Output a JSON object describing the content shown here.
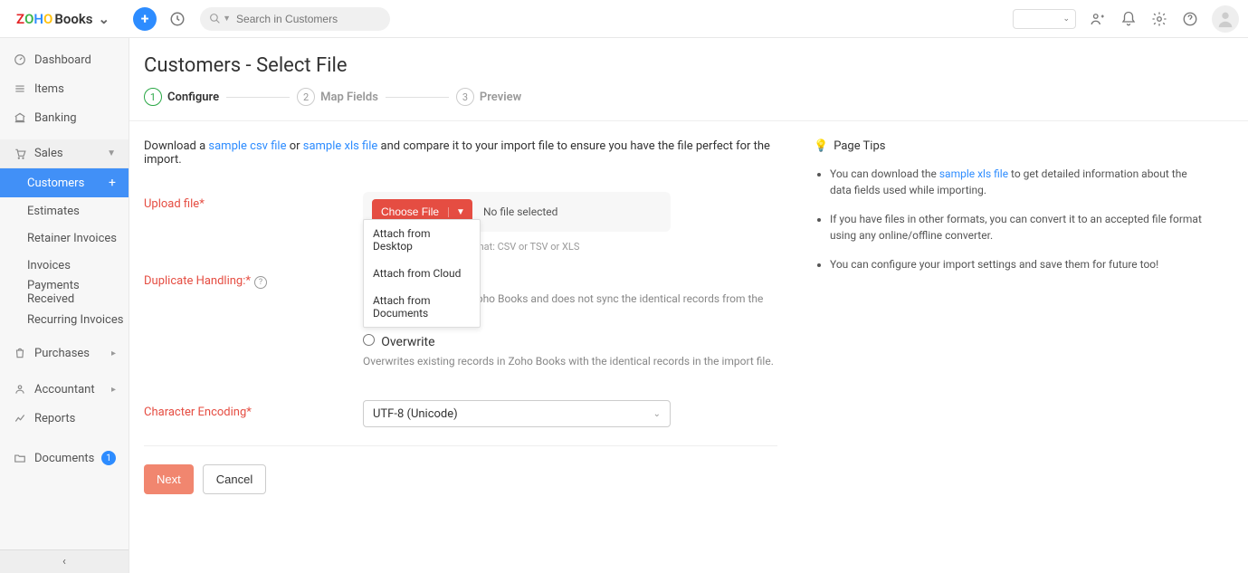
{
  "brand": {
    "books": "Books"
  },
  "search": {
    "placeholder": "Search in Customers"
  },
  "sidebar": {
    "items": [
      {
        "label": "Dashboard"
      },
      {
        "label": "Items"
      },
      {
        "label": "Banking"
      }
    ],
    "sales_label": "Sales",
    "sales_items": [
      "Customers",
      "Estimates",
      "Retainer Invoices",
      "Invoices",
      "Payments Received",
      "Recurring Invoices"
    ],
    "purchases_label": "Purchases",
    "accountant_label": "Accountant",
    "reports_label": "Reports",
    "documents_label": "Documents",
    "documents_badge": "1"
  },
  "page": {
    "title": "Customers - Select File"
  },
  "steps": [
    {
      "num": "1",
      "label": "Configure"
    },
    {
      "num": "2",
      "label": "Map Fields"
    },
    {
      "num": "3",
      "label": "Preview"
    }
  ],
  "intro": {
    "pre": "Download a ",
    "csv": "sample csv file",
    "or": " or ",
    "xls": "sample xls file",
    "post": " and compare it to your import file to ensure you have the file perfect for the import."
  },
  "form": {
    "upload_label": "Upload file*",
    "choose_file": "Choose File",
    "no_file": "No file selected",
    "file_format_prefix": "File Format: ",
    "file_format_value": "CSV or TSV or XLS",
    "attach_menu": [
      "Attach from Desktop",
      "Attach from Cloud",
      "Attach from Documents"
    ],
    "dup_label": "Duplicate Handling:*",
    "skip_desc": "Retains the records in Zoho Books and does not sync the identical records from the import file.",
    "overwrite_label": "Overwrite",
    "overwrite_desc": "Overwrites existing records in Zoho Books with the identical records in the import file.",
    "encoding_label": "Character Encoding*",
    "encoding_value": "UTF-8 (Unicode)",
    "next": "Next",
    "cancel": "Cancel"
  },
  "tips": {
    "title": "Page Tips",
    "items": [
      {
        "pre": "You can download the ",
        "link": "sample xls file",
        "post": " to get detailed information about the data fields used while importing."
      },
      {
        "text": "If you have files in other formats, you can convert it to an accepted file format using any online/offline converter."
      },
      {
        "text": "You can configure your import settings and save them for future too!"
      }
    ]
  }
}
